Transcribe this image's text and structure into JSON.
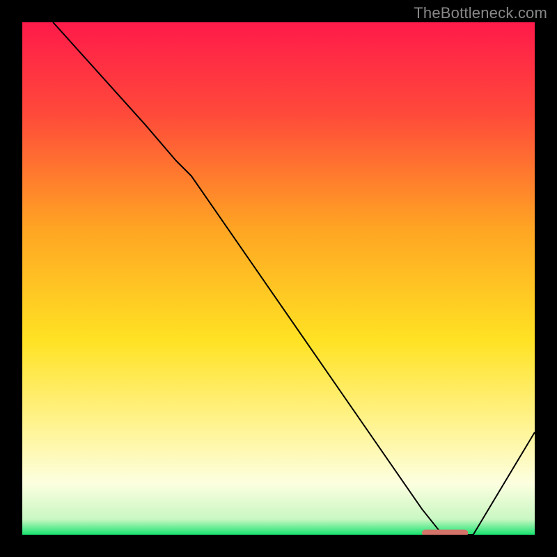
{
  "attribution": "TheBottleneck.com",
  "chart_data": {
    "type": "line",
    "title": "",
    "xlabel": "",
    "ylabel": "",
    "xlim": [
      0,
      100
    ],
    "ylim": [
      0,
      100
    ],
    "gradient_stops": [
      {
        "offset": 0,
        "color": "#ff1a4a"
      },
      {
        "offset": 18,
        "color": "#ff4a3a"
      },
      {
        "offset": 40,
        "color": "#ffa423"
      },
      {
        "offset": 62,
        "color": "#ffe223"
      },
      {
        "offset": 80,
        "color": "#fff59a"
      },
      {
        "offset": 90,
        "color": "#fcffe0"
      },
      {
        "offset": 97,
        "color": "#c9f7c2"
      },
      {
        "offset": 100,
        "color": "#17e36f"
      }
    ],
    "curve": {
      "x": [
        6,
        24,
        30,
        33,
        78,
        82,
        88,
        100
      ],
      "y": [
        100,
        80,
        73,
        70,
        5,
        0,
        0,
        20
      ]
    },
    "marker": {
      "x_start": 78,
      "x_end": 87,
      "y": 0,
      "color": "#d4736a"
    }
  }
}
